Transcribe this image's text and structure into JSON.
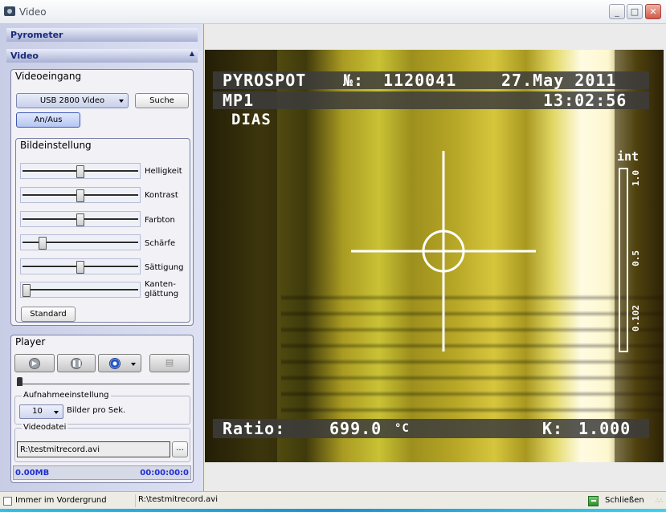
{
  "window": {
    "title": "Video",
    "min": "_",
    "max": "□",
    "close": "✕"
  },
  "left": {
    "pyrometer": "Pyrometer",
    "video": "Video",
    "videoeingang": {
      "title": "Videoeingang",
      "source": "USB 2800 Video",
      "suche": "Suche",
      "anaus": "An/Aus"
    },
    "bildeinstellung": {
      "title": "Bildeinstellung",
      "sliders": [
        {
          "label": "Helligkeit",
          "value": 0.5
        },
        {
          "label": "Kontrast",
          "value": 0.5
        },
        {
          "label": "Farbton",
          "value": 0.5
        },
        {
          "label": "Schärfe",
          "value": 0.15
        },
        {
          "label": "Sättigung",
          "value": 0.5
        },
        {
          "label": "Kanten-\nglättung",
          "value": 0.0
        }
      ],
      "standard": "Standard"
    },
    "player": {
      "title": "Player",
      "aufnahme": {
        "title": "Aufnahmeeinstellung",
        "fps": "10",
        "unit": "Bilder pro Sek."
      },
      "videodatei": {
        "title": "Videodatei",
        "path": "R:\\testmitrecord.avi",
        "browse": "..."
      },
      "size": "0.00MB",
      "time": "00:00:00:0"
    }
  },
  "osd": {
    "brand": "PYROSPOT",
    "serial_label": "№:",
    "serial": "1120041",
    "date": "27.May 2011",
    "mode": "MP1",
    "time": "13:02:56",
    "dias": "DIAS",
    "ratio_label": "Ratio:",
    "ratio_value": "699.0",
    "ratio_unit": "°C",
    "k_label": "K:",
    "k_value": "1.000",
    "int_label": "int",
    "scale": [
      "1.0",
      "0.5",
      "0.102"
    ]
  },
  "bottom": {
    "always_on_top": "Immer im Vordergrund",
    "file": "R:\\testmitrecord.avi",
    "close": "Schließen"
  }
}
